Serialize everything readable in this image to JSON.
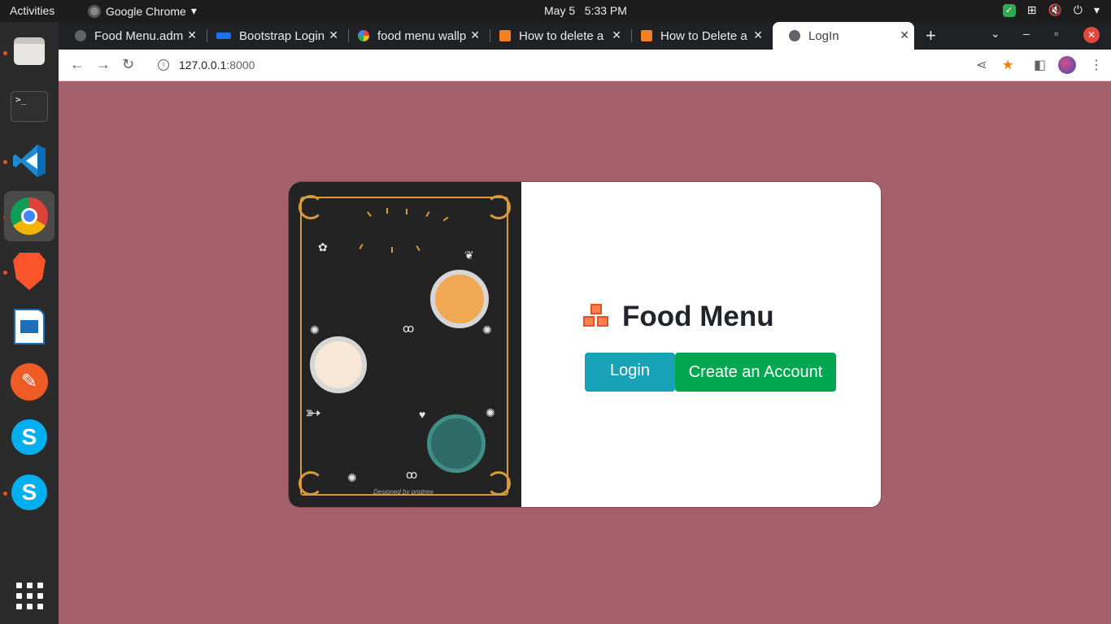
{
  "system": {
    "activities": "Activities",
    "app_name": "Google Chrome",
    "date": "May 5",
    "time": "5:33 PM"
  },
  "dock": {
    "terminal_glyph": ">_"
  },
  "browser": {
    "tabs": [
      {
        "title": "Food Menu.adm"
      },
      {
        "title": "Bootstrap Login"
      },
      {
        "title": "food menu wallp"
      },
      {
        "title": "How to delete a"
      },
      {
        "title": "How to Delete a"
      },
      {
        "title": "LogIn"
      }
    ],
    "url_host": "127.0.0.1",
    "url_port": ":8000"
  },
  "page": {
    "brand_title": "Food Menu",
    "login_label": "Login",
    "create_account_label": "Create an Account",
    "image_credit": "Designed by pngtree"
  },
  "colors": {
    "page_bg": "#a5616b",
    "login_btn": "#17a2b8",
    "create_btn": "#00a650",
    "brand_icon": "#fd7e4f"
  }
}
